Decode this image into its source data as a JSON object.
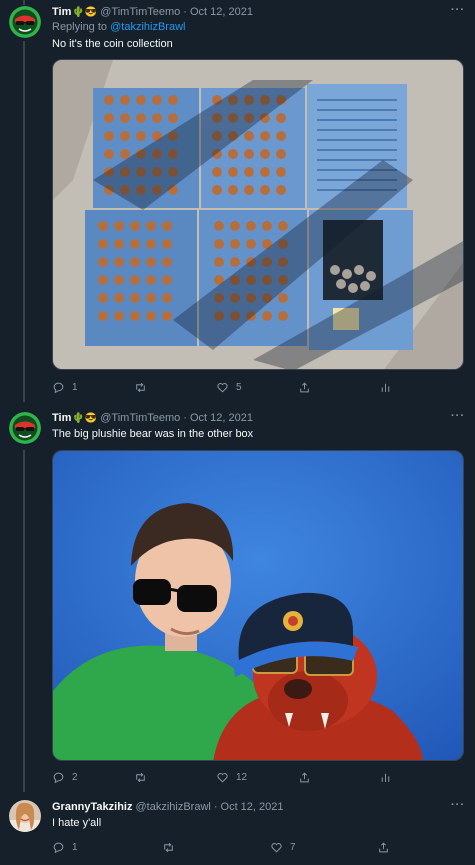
{
  "tweets": [
    {
      "name": "Tim",
      "name_emojis": "🌵😎",
      "handle": "@TimTimTeemo",
      "date": "Oct 12, 2021",
      "replying_to_label": "Replying to",
      "replying_to_handle": "@takzihizBrawl",
      "text": "No it's the coin collection",
      "replies": "1",
      "retweets": "",
      "likes": "5",
      "image_description": "coin-collection-folders"
    },
    {
      "name": "Tim",
      "name_emojis": "🌵😎",
      "handle": "@TimTimTeemo",
      "date": "Oct 12, 2021",
      "text": "The big plushie bear was in the other box",
      "replies": "2",
      "retweets": "",
      "likes": "12",
      "image_description": "selfie-with-plush-bear"
    },
    {
      "name": "GrannyTakzihiz",
      "handle": "@takzihizBrawl",
      "date": "Oct 12, 2021",
      "text": "I hate y'all",
      "replies": "1",
      "retweets": "",
      "likes": "7"
    }
  ],
  "separator": "·",
  "more_label": "···",
  "colors": {
    "background": "#15202b",
    "secondary_text": "#8b98a5",
    "link": "#1d9bf0",
    "border": "#38444d"
  }
}
